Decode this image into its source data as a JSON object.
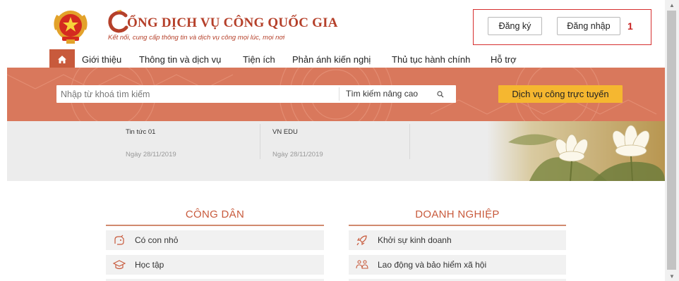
{
  "header": {
    "title": "CỔNG DỊCH VỤ CÔNG QUỐC GIA",
    "title_rest": "ỔNG DỊCH VỤ CÔNG QUỐC GIA",
    "subtitle": "Kết nối, cung cấp thông tin và dịch vụ công mọi lúc, mọi nơi",
    "register_label": "Đăng ký",
    "login_label": "Đăng nhập",
    "annotation_number": "1",
    "annotation_color": "#d62f2f"
  },
  "nav": {
    "home_icon": "home-icon",
    "items": [
      "Giới thiệu",
      "Thông tin và dịch vụ",
      "Tiện ích",
      "Phản ánh kiến nghị",
      "Thủ tục hành chính",
      "Hỗ trợ"
    ]
  },
  "search": {
    "placeholder": "Nhập từ khoá tìm kiếm",
    "advanced_label": "Tìm kiếm nâng cao",
    "search_icon": "search-icon",
    "online_services_label": "Dịch vụ công trực tuyến"
  },
  "news": [
    {
      "title": "Tin tức 01",
      "date": "Ngày 28/11/2019"
    },
    {
      "title": "VN EDU",
      "date": "Ngày 28/11/2019"
    }
  ],
  "categories": {
    "citizen": {
      "title": "CÔNG DÂN",
      "items": [
        {
          "label": "Có con nhỏ",
          "icon": "baby-icon"
        },
        {
          "label": "Học tập",
          "icon": "graduation-cap-icon"
        }
      ]
    },
    "business": {
      "title": "DOANH NGHIỆP",
      "items": [
        {
          "label": "Khởi sự kinh doanh",
          "icon": "rocket-icon"
        },
        {
          "label": "Lao động và bảo hiểm xã hội",
          "icon": "workers-icon"
        }
      ]
    }
  },
  "colors": {
    "brand": "#b5402a",
    "accent": "#c85a3c",
    "banner": "#d9785c",
    "button_yellow": "#f5b730"
  }
}
